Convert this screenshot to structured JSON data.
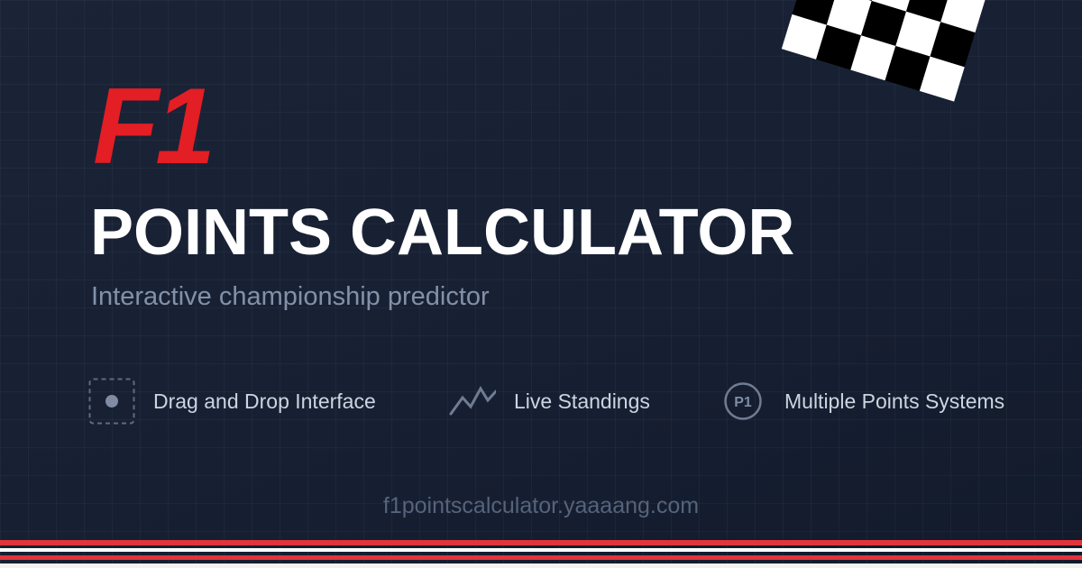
{
  "brand": {
    "logo_text": "F1",
    "title": "POINTS CALCULATOR",
    "subtitle": "Interactive championship predictor",
    "accent_color": "#e31e24"
  },
  "features": [
    {
      "label": "Drag and Drop Interface",
      "icon": "drag-drop-icon"
    },
    {
      "label": "Live Standings",
      "icon": "trend-line-icon"
    },
    {
      "label": "Multiple Points Systems",
      "icon": "p1-badge-icon",
      "icon_text": "P1"
    }
  ],
  "footer": {
    "url": "f1pointscalculator.yaaaang.com"
  },
  "decor": {
    "flag_icon": "checkered-flag-icon",
    "stripe_colors": [
      "#e0353b",
      "#ffffff"
    ]
  }
}
